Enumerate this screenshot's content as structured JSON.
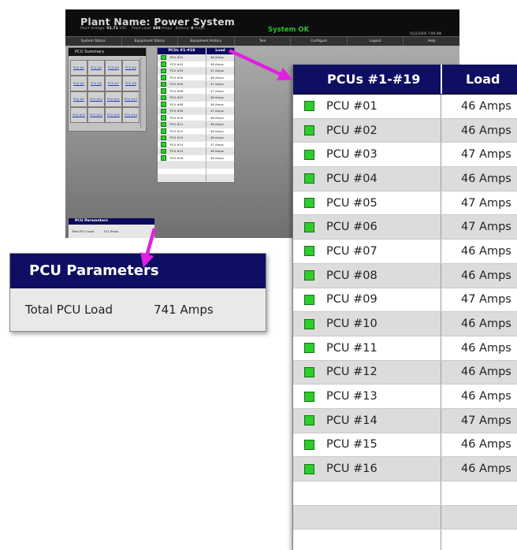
{
  "header": {
    "plant_name": "Plant Name: Power System",
    "plant_voltage_label": "Plant Voltage:",
    "plant_voltage_value": "52.71",
    "plant_voltage_unit": "VDC",
    "plant_load_label": "Plant Load:",
    "plant_load_value": "689",
    "plant_load_unit": "Amps",
    "battery_label": "Battery:",
    "battery_value": "0",
    "battery_unit": "Amps",
    "status": "System OK",
    "datetime": "01/2/2005 7:09 AM"
  },
  "nav": {
    "items": [
      {
        "label": "System Status"
      },
      {
        "label": "Equipment Status"
      },
      {
        "label": "Equipment History"
      },
      {
        "label": "Tool"
      },
      {
        "label": "Configure"
      },
      {
        "label": "Logout"
      },
      {
        "label": "Help"
      }
    ]
  },
  "summary": {
    "title": "PCU Summary",
    "buttons": [
      "PCU #1",
      "PCU #2",
      "PCU #3",
      "PCU #4",
      "PCU #5",
      "PCU #6",
      "PCU #7",
      "PCU #8",
      "PCU #9",
      "PCU #10",
      "PCU #11",
      "PCU #12",
      "PCU #13",
      "PCU #14",
      "PCU #15",
      "PCU #16"
    ]
  },
  "table": {
    "col1_header": "PCUs #1-#19",
    "col2_header": "Load",
    "rows": [
      {
        "name": "PCU #01",
        "load": "46 Amps"
      },
      {
        "name": "PCU #02",
        "load": "46 Amps"
      },
      {
        "name": "PCU #03",
        "load": "47 Amps"
      },
      {
        "name": "PCU #04",
        "load": "46 Amps"
      },
      {
        "name": "PCU #05",
        "load": "47 Amps"
      },
      {
        "name": "PCU #06",
        "load": "47 Amps"
      },
      {
        "name": "PCU #07",
        "load": "46 Amps"
      },
      {
        "name": "PCU #08",
        "load": "46 Amps"
      },
      {
        "name": "PCU #09",
        "load": "47 Amps"
      },
      {
        "name": "PCU #10",
        "load": "46 Amps"
      },
      {
        "name": "PCU #11",
        "load": "46 Amps"
      },
      {
        "name": "PCU #12",
        "load": "46 Amps"
      },
      {
        "name": "PCU #13",
        "load": "46 Amps"
      },
      {
        "name": "PCU #14",
        "load": "47 Amps"
      },
      {
        "name": "PCU #15",
        "load": "46 Amps"
      },
      {
        "name": "PCU #16",
        "load": "46 Amps"
      }
    ]
  },
  "parameters": {
    "title": "PCU Parameters",
    "total_label": "Total PCU Load",
    "total_value": "741 Amps"
  },
  "colors": {
    "header_navy": "#0e0e62",
    "status_green": "#2fbd2f",
    "indicator_green": "#2fcb2f",
    "arrow_magenta": "#e020e0"
  },
  "icons": {
    "status_indicator": "green-square-icon",
    "callout": "magenta-arrow-icon"
  }
}
